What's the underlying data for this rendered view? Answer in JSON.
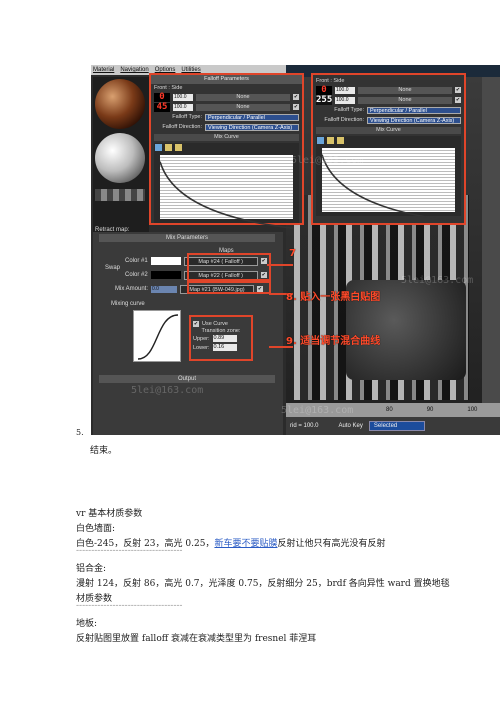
{
  "screenshot": {
    "menu": [
      "Material",
      "Navigation",
      "Options",
      "Utilities"
    ],
    "retract_label": "Retract map:",
    "watermark": "5lei@163.com",
    "falloff_left": {
      "title": "Falloff Parameters",
      "front_side": "Front : Side",
      "row1": {
        "num": "0",
        "value": "100.0",
        "map": "None"
      },
      "row2": {
        "num": "45",
        "value": "100.0",
        "map": "None"
      },
      "falloff_type_label": "Falloff Type:",
      "falloff_type": "Perpendicular / Parallel",
      "falloff_dir_label": "Falloff Direction:",
      "falloff_dir": "Viewing Direction (Camera Z-Axis)",
      "mix_curve": "Mix Curve"
    },
    "falloff_right": {
      "front_side": "Front : Side",
      "row1": {
        "num": "0",
        "value": "100.0",
        "map": "None"
      },
      "row2": {
        "num": "255",
        "value": "100.0",
        "map": "None"
      },
      "falloff_type_label": "Falloff Type:",
      "falloff_type": "Perpendicular / Parallel",
      "falloff_dir_label": "Falloff Direction:",
      "falloff_dir": "Viewing Direction (Camera Z-Axis)",
      "mix_curve": "Mix Curve"
    },
    "mix_params": {
      "title": "Mix Parameters",
      "maps_label": "Maps",
      "swap": "Swap",
      "color1_label": "Color #1",
      "color1_map": "Map #24  ( Falloff )",
      "color2_label": "Color #2",
      "color2_map": "Map #22  ( Falloff )",
      "mix_amount_label": "Mix Amount:",
      "mix_amount_value": "0.0",
      "mix_amount_map": "Map #21 (BW-049.jpg)",
      "mixing_curve": "Mixing curve",
      "use_curve": "Use Curve",
      "transition_zone": "Transition zone:",
      "upper_label": "Upper:",
      "upper_value": "0.89",
      "lower_label": "Lower:",
      "lower_value": "0.16",
      "output": "Output"
    },
    "annotations": {
      "a7": "7",
      "a8": "8. 贴入一张黑白贴图",
      "a9": "9. 适当调节混合曲线"
    },
    "timeline_ticks": [
      "80",
      "90",
      "100"
    ],
    "status": {
      "grid": "rid = 100.0",
      "auto_key": "Auto Key",
      "selected": "Selected"
    }
  },
  "doc": {
    "item5": "5.",
    "end": "结束。",
    "vr_title": "vr 基本材质参数",
    "white_wall_title": "白色墙面:",
    "white_wall_prefix": "白色-245，反射 23，高光 0.25，",
    "white_wall_link": "新车要不要贴膜",
    "white_wall_suffix": "反射让他只有高光没有反射",
    "divider": "-----------------------------------",
    "alloy_title": "铝合金:",
    "alloy_line1": "漫射 124，反射 86，高光 0.7，光泽度 0.75，反射细分 25，brdf 各向异性 ward 置换地毯",
    "alloy_line2": "材质参数",
    "floor_title": "地板:",
    "floor_line": "反射贴图里放置 falloff 衰减在衰减类型里为 fresnel 菲涅耳"
  }
}
